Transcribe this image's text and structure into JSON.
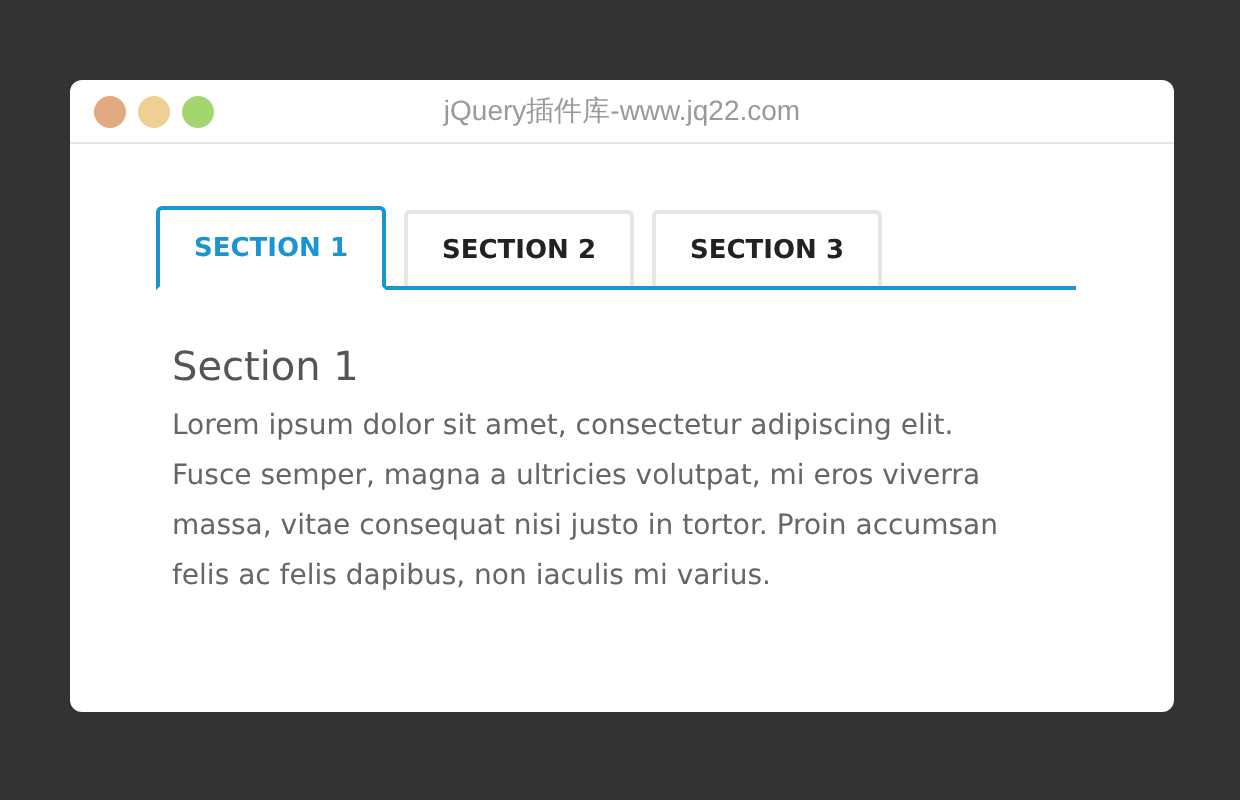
{
  "window": {
    "title": "jQuery插件库-www.jq22.com"
  },
  "tabs": [
    {
      "label": "SECTION 1",
      "selected": true
    },
    {
      "label": "SECTION 2",
      "selected": false
    },
    {
      "label": "SECTION 3",
      "selected": false
    }
  ],
  "panel": {
    "heading": "Section 1",
    "text": "Lorem ipsum dolor sit amet, consectetur adipiscing elit. Fusce semper, magna a ultricies volutpat, mi eros viverra massa, vitae consequat nisi justo in tortor. Proin accumsan felis ac felis dapibus, non iaculis mi varius."
  }
}
